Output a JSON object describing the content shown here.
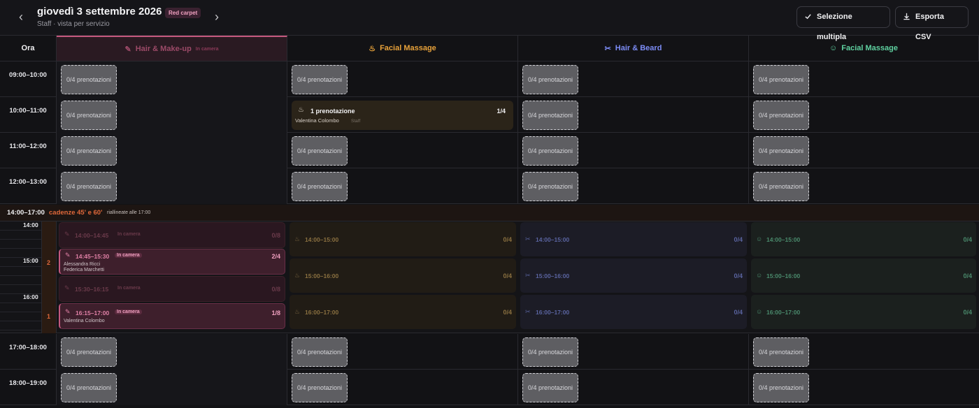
{
  "header": {
    "title": "giovedì 3 settembre 2026",
    "badge": "Red carpet",
    "subtitle": "Staff · vista per servizio",
    "prev": "‹",
    "next": "›",
    "multi_select": "Selezione multipla",
    "export": "Esporta CSV"
  },
  "columns": {
    "time": "Ora",
    "c1": {
      "name": "Hair & Make-up",
      "tag": "In camera",
      "color": "#c4587e"
    },
    "c2": {
      "name": "Facial Massage",
      "color": "#e8a23a"
    },
    "c3": {
      "name": "Hair & Beard",
      "color": "#7c8cf5"
    },
    "c4": {
      "name": "Facial Massage",
      "color": "#5fd1a0"
    }
  },
  "rows_top": [
    {
      "time": "09:00–10:00",
      "cells": [
        "0/4 prenotazioni",
        "0/4 prenotazioni",
        "0/4 prenotazioni",
        "0/4 prenotazioni"
      ]
    },
    {
      "time": "10:00–11:00",
      "cells": [
        "0/4 prenotazioni",
        "",
        "0/4 prenotazioni",
        "0/4 prenotazioni"
      ]
    },
    {
      "time": "11:00–12:00",
      "cells": [
        "0/4 prenotazioni",
        "0/4 prenotazioni",
        "0/4 prenotazioni",
        "0/4 prenotazioni"
      ]
    },
    {
      "time": "12:00–13:00",
      "cells": [
        "0/4 prenotazioni",
        "0/4 prenotazioni",
        "0/4 prenotazioni",
        "0/4 prenotazioni"
      ]
    }
  ],
  "booking": {
    "title": "1 prenotazione",
    "count": "1/4",
    "name": "Valentina Colombo",
    "role": "Staff"
  },
  "segment": {
    "range": "14:00–17:00",
    "cadence": "cadenze 45' e 60'",
    "note": "riallineate alle 17:00"
  },
  "seg_hours": [
    "14:00",
    "15:00",
    "16:00"
  ],
  "seg_markers": [
    "2",
    "1"
  ],
  "hm_slots": [
    {
      "time": "14:00–14:45",
      "tag": "In camera",
      "count": "0/8",
      "names": []
    },
    {
      "time": "14:45–15:30",
      "tag": "In camera",
      "count": "2/4",
      "names": [
        "Alessandra Ricci",
        "Federica Marchetti"
      ]
    },
    {
      "time": "15:30–16:15",
      "tag": "In camera",
      "count": "0/8",
      "names": []
    },
    {
      "time": "16:15–17:00",
      "tag": "In camera",
      "count": "1/8",
      "names": [
        "Valentina Colombo"
      ]
    }
  ],
  "hour_slots": {
    "times": [
      "14:00–15:00",
      "15:00–16:00",
      "16:00–17:00"
    ],
    "count": "0/4"
  },
  "rows_bottom": [
    {
      "time": "17:00–18:00",
      "cells": [
        "0/4 prenotazioni",
        "0/4 prenotazioni",
        "0/4 prenotazioni",
        "0/4 prenotazioni"
      ]
    },
    {
      "time": "18:00–19:00",
      "cells": [
        "0/4 prenotazioni",
        "0/4 prenotazioni",
        "0/4 prenotazioni",
        "0/4 prenotazioni"
      ]
    }
  ]
}
